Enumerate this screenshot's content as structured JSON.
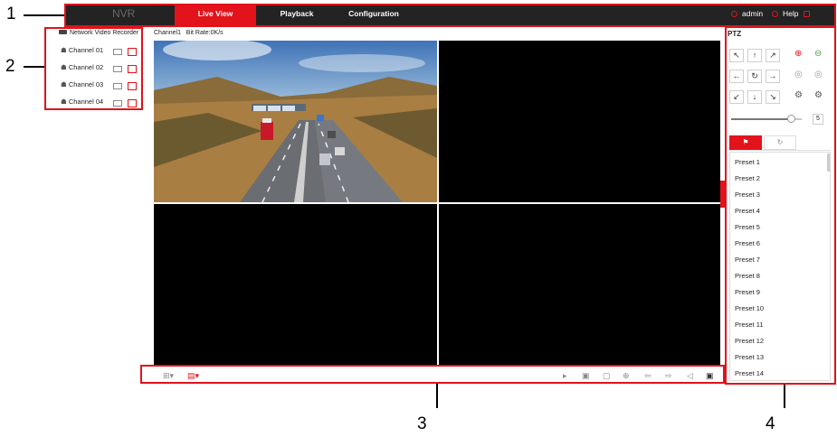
{
  "callouts": {
    "top": "1",
    "left": "2",
    "bottom": "3",
    "right": "4"
  },
  "topbar": {
    "logo": "NVR",
    "tabs": [
      {
        "label": "Live View",
        "active": true
      },
      {
        "label": "Playback",
        "active": false
      },
      {
        "label": "Configuration",
        "active": false
      }
    ],
    "user": "admin",
    "help": "Help",
    "logout": "Logout"
  },
  "device_tree": {
    "root": "Network Video Recorder",
    "channels": [
      "Channel 01",
      "Channel 02",
      "Channel 03",
      "Channel 04"
    ]
  },
  "video": {
    "info": "Channel1   Bit Rate:0K/s"
  },
  "ptz": {
    "title": "PTZ",
    "speed": "5",
    "speed_level_fraction": 0.85,
    "presets": [
      "Preset 1",
      "Preset 2",
      "Preset 3",
      "Preset 4",
      "Preset 5",
      "Preset 6",
      "Preset 7",
      "Preset 8",
      "Preset 9",
      "Preset 10",
      "Preset 11",
      "Preset 12",
      "Preset 13",
      "Preset 14"
    ]
  },
  "colors": {
    "accent": "#e3131b",
    "topbar": "#232323",
    "callout_box": "#e0131b"
  }
}
